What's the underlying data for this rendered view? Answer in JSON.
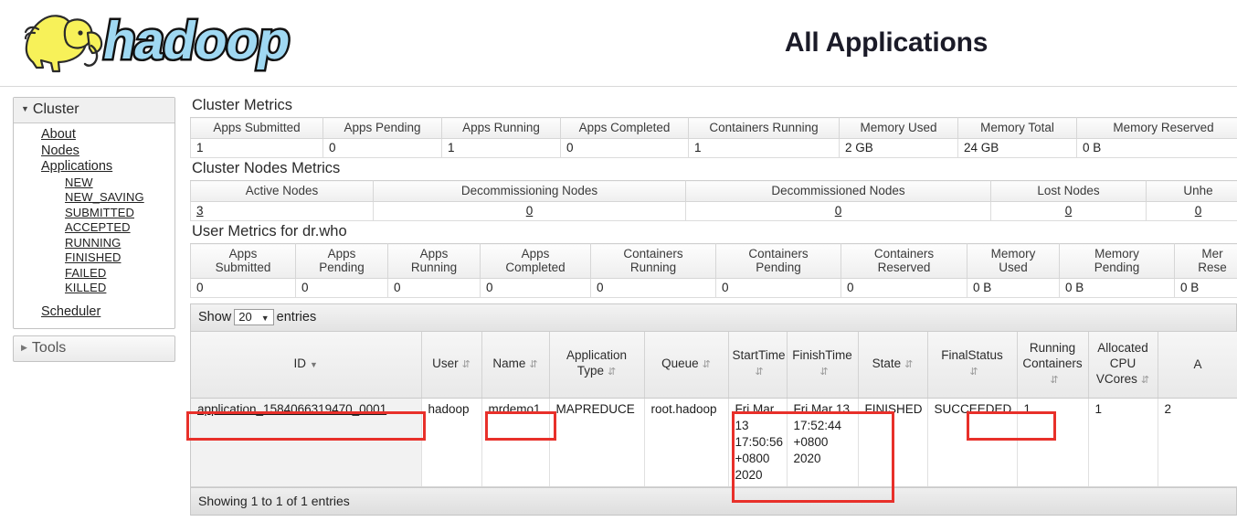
{
  "header": {
    "title": "All Applications",
    "logo_alt": "hadoop"
  },
  "sidebar": {
    "cluster": {
      "label": "Cluster",
      "items": [
        {
          "label": "About"
        },
        {
          "label": "Nodes"
        },
        {
          "label": "Applications"
        }
      ],
      "app_states": [
        {
          "label": "NEW"
        },
        {
          "label": "NEW_SAVING"
        },
        {
          "label": "SUBMITTED"
        },
        {
          "label": "ACCEPTED"
        },
        {
          "label": "RUNNING"
        },
        {
          "label": "FINISHED"
        },
        {
          "label": "FAILED"
        },
        {
          "label": "KILLED"
        }
      ],
      "scheduler": {
        "label": "Scheduler"
      }
    },
    "tools": {
      "label": "Tools"
    }
  },
  "cluster_metrics": {
    "title": "Cluster Metrics",
    "headers": [
      "Apps Submitted",
      "Apps Pending",
      "Apps Running",
      "Apps Completed",
      "Containers Running",
      "Memory Used",
      "Memory Total",
      "Memory Reserved"
    ],
    "values": [
      "1",
      "0",
      "1",
      "0",
      "1",
      "2 GB",
      "24 GB",
      "0 B"
    ]
  },
  "cluster_nodes_metrics": {
    "title": "Cluster Nodes Metrics",
    "headers": [
      "Active Nodes",
      "Decommissioning Nodes",
      "Decommissioned Nodes",
      "Lost Nodes",
      "Unhe"
    ],
    "values": [
      "3",
      "0",
      "0",
      "0",
      "0"
    ]
  },
  "user_metrics": {
    "title": "User Metrics for dr.who",
    "headers": [
      "Apps\nSubmitted",
      "Apps\nPending",
      "Apps\nRunning",
      "Apps\nCompleted",
      "Containers\nRunning",
      "Containers\nPending",
      "Containers\nReserved",
      "Memory\nUsed",
      "Memory\nPending",
      "Mem\nRese"
    ],
    "headers_l1": [
      "Apps",
      "Apps",
      "Apps",
      "Apps",
      "Containers",
      "Containers",
      "Containers",
      "Memory",
      "Memory",
      "Mer"
    ],
    "headers_l2": [
      "Submitted",
      "Pending",
      "Running",
      "Completed",
      "Running",
      "Pending",
      "Reserved",
      "Used",
      "Pending",
      "Rese"
    ],
    "values": [
      "0",
      "0",
      "0",
      "0",
      "0",
      "0",
      "0",
      "0 B",
      "0 B",
      "0 B"
    ]
  },
  "apps_table": {
    "show_label": "Show",
    "show_value": "20",
    "entries_label": "entries",
    "columns": [
      {
        "label": "ID",
        "sort": "desc"
      },
      {
        "label": "User",
        "sort": "both"
      },
      {
        "label": "Name",
        "sort": "both"
      },
      {
        "label": "Application\nType",
        "sort": "both"
      },
      {
        "label": "Queue",
        "sort": "both"
      },
      {
        "label": "StartTime",
        "sort": "both"
      },
      {
        "label": "FinishTime",
        "sort": "both"
      },
      {
        "label": "State",
        "sort": "both"
      },
      {
        "label": "FinalStatus",
        "sort": "both"
      },
      {
        "label": "Running\nContainers",
        "sort": "both"
      },
      {
        "label": "Allocated\nCPU\nVCores",
        "sort": "both"
      },
      {
        "label": "A",
        "sort": "none"
      }
    ],
    "column_labels": {
      "id": "ID",
      "user": "User",
      "name": "Name",
      "app_type_l1": "Application",
      "app_type_l2": "Type",
      "queue": "Queue",
      "start_time": "StartTime",
      "finish_time": "FinishTime",
      "state": "State",
      "final_status": "FinalStatus",
      "running_containers_l1": "Running",
      "running_containers_l2": "Containers",
      "alloc_cpu_l1": "Allocated",
      "alloc_cpu_l2": "CPU",
      "alloc_cpu_l3": "VCores",
      "truncated": "A"
    },
    "rows": [
      {
        "id": "application_1584066319470_0001",
        "user": "hadoop",
        "name": "mrdemo1",
        "application_type": "MAPREDUCE",
        "queue": "root.hadoop",
        "start_time": "Fri Mar 13 17:50:56 +0800 2020",
        "finish_time": "Fri Mar 13 17:52:44 +0800 2020",
        "state": "FINISHED",
        "final_status": "SUCCEEDED",
        "running_containers": "1",
        "allocated_cpu_vcores": "1",
        "truncated": "2"
      }
    ],
    "footer": "Showing 1 to 1 of 1 entries"
  },
  "annotations": {
    "color": "#e8302a",
    "boxes": [
      "application-id",
      "name",
      "start-finish-time",
      "final-status"
    ]
  }
}
